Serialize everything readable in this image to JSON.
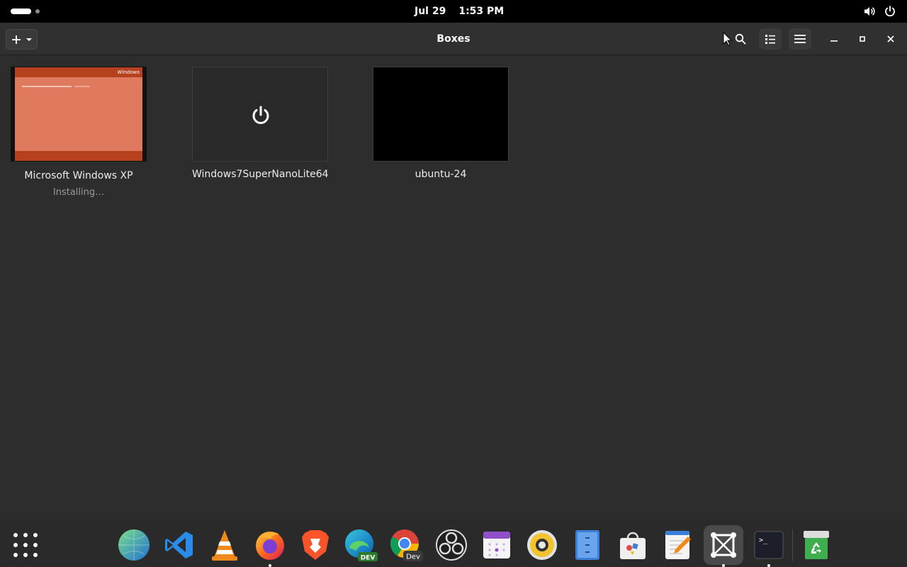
{
  "topbar": {
    "date": "Jul 29",
    "time": "1:53 PM",
    "icons": [
      "volume-icon",
      "power-icon"
    ]
  },
  "header": {
    "title": "Boxes",
    "new_box_icon": "plus-icon",
    "buttons": [
      "search-icon",
      "list-view-icon",
      "hamburger-menu-icon"
    ],
    "window_controls": [
      "minimize-icon",
      "maximize-icon",
      "close-icon"
    ]
  },
  "boxes": [
    {
      "name": "Microsoft Windows XP",
      "status": "Installing…",
      "thumb_text": "Windows"
    },
    {
      "name": "Windows7SuperNanoLite64",
      "status": ""
    },
    {
      "name": "ubuntu-24",
      "status": ""
    }
  ],
  "dock": {
    "items": [
      "show-apps-icon",
      "globe-browser-icon",
      "vscode-icon",
      "vlc-icon",
      "firefox-icon",
      "brave-icon",
      "edge-dev-icon",
      "chrome-dev-icon",
      "obs-icon",
      "calendar-icon",
      "speaker-icon",
      "files-icon",
      "software-store-icon",
      "text-editor-icon",
      "boxes-icon",
      "terminal-icon",
      "trash-icon"
    ],
    "edge_label": "DEV",
    "chrome_label": "Dev",
    "terminal_prompt": ">_"
  },
  "colors": {
    "topbar_bg": "#000000",
    "window_bg": "#2d2d2d",
    "xp_thumb": "#e07a5f",
    "xp_bar": "#b5411f"
  }
}
